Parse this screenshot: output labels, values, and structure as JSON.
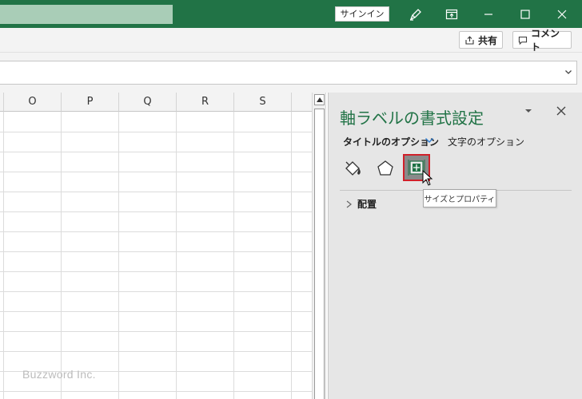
{
  "titlebar": {
    "signin_label": "サインイン",
    "icons": [
      "pen-icon",
      "restore-ribbon-icon",
      "minimize-icon",
      "maximize-icon",
      "close-icon"
    ],
    "accent": "#217346"
  },
  "ribbon": {
    "share_label": "共有",
    "comment_label": "コメント"
  },
  "grid": {
    "columns": [
      "O",
      "P",
      "Q",
      "R",
      "S"
    ]
  },
  "pane": {
    "title": "軸ラベルの書式設定",
    "title_options_label": "タイトルのオプション",
    "text_options_label": "文字のオプション",
    "icons": [
      "fill-line-icon",
      "effects-icon",
      "size-properties-icon"
    ],
    "tooltip": "サイズとプロパティ",
    "section_label": "配置"
  },
  "watermark": "Buzzword Inc."
}
